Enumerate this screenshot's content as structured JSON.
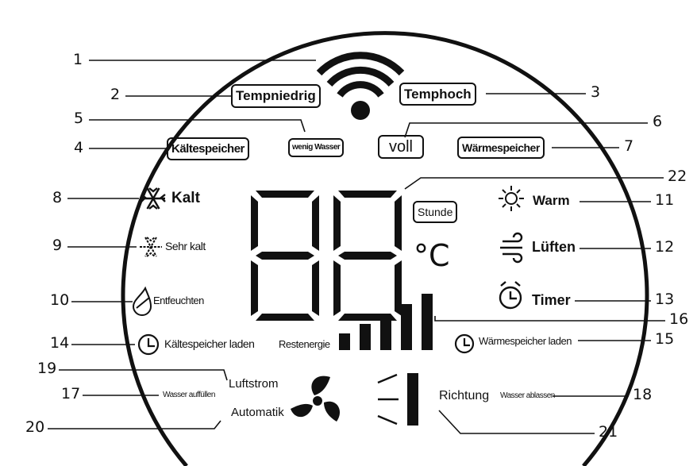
{
  "colors": {
    "ink": "#111111",
    "background": "#ffffff"
  },
  "numbers": {
    "n1": "1",
    "n2": "2",
    "n3": "3",
    "n4": "4",
    "n5": "5",
    "n6": "6",
    "n7": "7",
    "n8": "8",
    "n9": "9",
    "n10": "10",
    "n11": "11",
    "n12": "12",
    "n13": "13",
    "n14": "14",
    "n15": "15",
    "n16": "16",
    "n17": "17",
    "n18": "18",
    "n19": "19",
    "n20": "20",
    "n21": "21",
    "n22": "22"
  },
  "labels": {
    "temp_low": "Tempniedrig",
    "temp_high": "Temphoch",
    "cold_storage": "Kältespeicher",
    "low_water": "wenig Wasser",
    "full": "voll",
    "heat_storage": "Wärmespeicher",
    "cold": "Kalt",
    "very_cold": "Sehr kalt",
    "dehumidify": "Entfeuchten",
    "warm": "Warm",
    "ventilate": "Lüften",
    "timer": "Timer",
    "hour": "Stunde",
    "celsius": "°C",
    "cold_storage_charge": "Kältespeicher laden",
    "remaining_energy": "Restenergie",
    "heat_storage_charge": "Wärmespeicher laden",
    "airflow": "Luftstrom",
    "refill_water": "Wasser auffüllen",
    "auto": "Automatik",
    "direction": "Richtung",
    "drain_water": "Wasser ablassen"
  },
  "icons": [
    "wifi-icon",
    "snowflake-icon",
    "snowflake-dotted-icon",
    "droplet-icon",
    "sun-icon",
    "wind-icon",
    "alarm-clock-icon",
    "clock-icon",
    "fan-icon",
    "swing-direction-icon",
    "signal-bars-icon",
    "seven-segment-digit"
  ],
  "display": {
    "digits": "88",
    "energy_level_bars": 5
  }
}
